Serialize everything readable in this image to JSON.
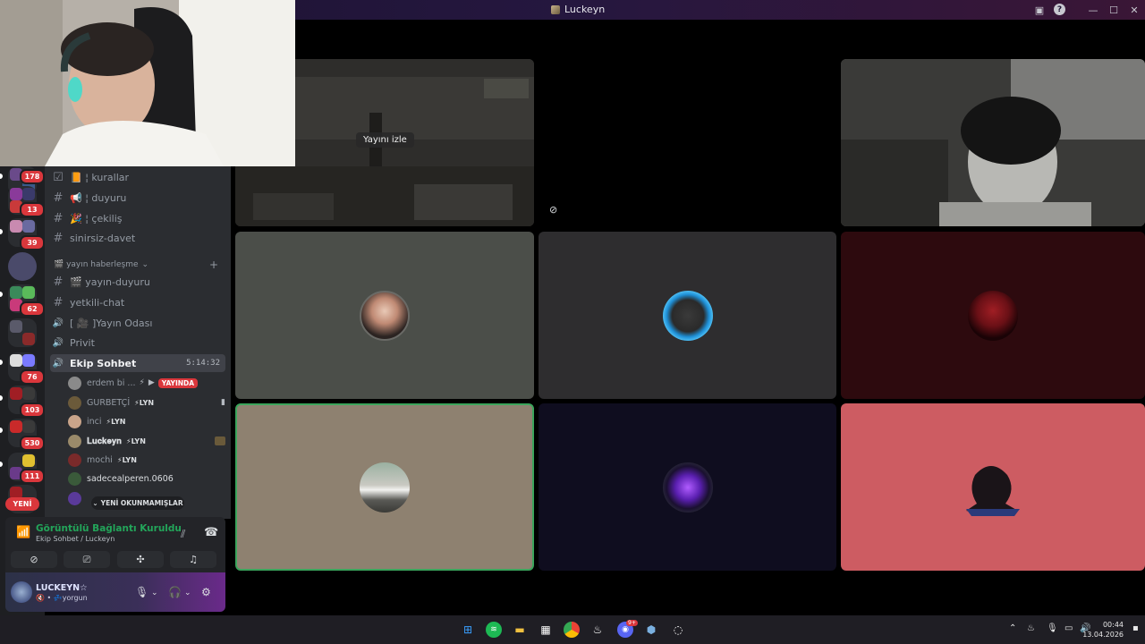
{
  "window": {
    "title": "Luckeyn"
  },
  "servers": {
    "badges": [
      "178",
      "13",
      "39",
      "62",
      "76",
      "103",
      "530",
      "111"
    ],
    "new_label": "YENİ"
  },
  "channels": {
    "items": [
      {
        "icon": "rules-icon",
        "symbol": "☑",
        "label": "📙 ¦ kurallar"
      },
      {
        "icon": "text-channel-icon",
        "symbol": "#",
        "label": "📢 ¦ duyuru"
      },
      {
        "icon": "text-channel-icon",
        "symbol": "#",
        "label": "🎉 ¦ çekiliş"
      },
      {
        "icon": "text-channel-icon",
        "symbol": "#",
        "label": "sinirsiz-davet"
      }
    ],
    "category": "🎬 yayın haberleşme",
    "items2": [
      {
        "icon": "text-channel-icon",
        "symbol": "#",
        "label": "🎬 yayın-duyuru"
      },
      {
        "icon": "text-channel-icon",
        "symbol": "#",
        "label": "yetkili-chat"
      },
      {
        "icon": "voice-channel-icon",
        "symbol": "🔊",
        "label": "[ 🎥 ]Yayın Odası"
      },
      {
        "icon": "voice-channel-icon",
        "symbol": "🔊",
        "label": "Privit"
      }
    ],
    "active": {
      "label": "Ekip Sohbet",
      "time": "5:14:32"
    },
    "voice_users": [
      {
        "name": "erdem bi ...",
        "tag": "",
        "live": "YAYINDA",
        "color": "#8a8a8a"
      },
      {
        "name": "GURBETÇİ",
        "tag": "⚡LYN",
        "live": "",
        "color": "#6b5a3a"
      },
      {
        "name": "inci",
        "tag": "⚡LYN",
        "live": "",
        "color": "#c9a48a"
      },
      {
        "name": "𝐋𝐮𝐜𝐤𝐞𝐲𝐧",
        "tag": "⚡LYN",
        "live": "",
        "color": "#9a8a6a"
      },
      {
        "name": "mochi",
        "tag": "⚡LYN",
        "live": "",
        "color": "#7a2a2a"
      },
      {
        "name": "sadecealperen.0606",
        "tag": "",
        "live": "",
        "color": "#3a5a3a"
      }
    ],
    "unread_label": "YENİ OKUNMAMIŞLAR"
  },
  "voice_panel": {
    "status": "Görüntülü Bağlantı Kuruldu",
    "subtitle": "Ekip Sohbet / Luckeyn"
  },
  "user_panel": {
    "name": "LUCKEYN☆",
    "status": "🔇 • 💤yorgun"
  },
  "stage": {
    "watch_label": "Yayını izle"
  },
  "taskbar": {
    "time": "00:44",
    "date": "13.04.2026",
    "discord_badge": "9+"
  },
  "colors": {
    "connected": "#23a55a",
    "badge_red": "#da373c",
    "tile_gray": "#4b4e49",
    "tile_dark": "#2e2d2f",
    "tile_maroon": "#2d0a0e",
    "tile_beige": "#8e8170",
    "tile_navy": "#0f0d1f",
    "tile_pink": "#cd5c62",
    "speaking_border": "#3ba55c"
  }
}
